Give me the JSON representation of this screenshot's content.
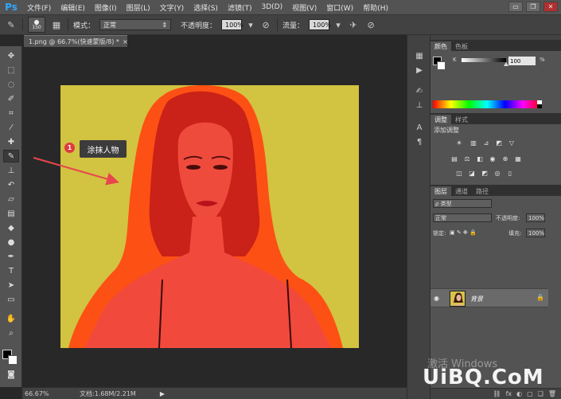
{
  "app": {
    "logo": "Ps"
  },
  "menubar": {
    "items": [
      "文件(F)",
      "编辑(E)",
      "图像(I)",
      "图层(L)",
      "文字(Y)",
      "选择(S)",
      "滤镜(T)",
      "3D(D)",
      "视图(V)",
      "窗口(W)",
      "帮助(H)"
    ]
  },
  "window_controls": {
    "minimize": "▭",
    "restore": "❐",
    "close": "✕"
  },
  "options": {
    "brush_size": "150",
    "mode_label": "模式：",
    "mode_value": "正常",
    "opacity_label": "不透明度：",
    "opacity_value": "100%",
    "flow_label": "流量：",
    "flow_value": "100%"
  },
  "document": {
    "tab_title": "1.png @ 66.7%(快速蒙版/8) *",
    "tab_close": "×"
  },
  "annotation": {
    "number": "1",
    "text": "涂抹人物"
  },
  "status": {
    "zoom": "66.67%",
    "doc_size": "文档:1.68M/2.21M",
    "arrow": "▶"
  },
  "color_panel": {
    "tabs": [
      "颜色",
      "色板"
    ],
    "channel_label": "K",
    "channel_value": "100",
    "unit": "%"
  },
  "adjustments_panel": {
    "tabs": [
      "调整",
      "样式"
    ],
    "title": "添加调整"
  },
  "layers_panel": {
    "tabs": [
      "图层",
      "通道",
      "路径"
    ],
    "kind_filter": "ρ 类型",
    "blend_mode": "正常",
    "opacity_label": "不透明度:",
    "opacity_value": "100%",
    "lock_label": "锁定:",
    "fill_label": "填充:",
    "fill_value": "100%",
    "layer_name": "背景",
    "footer_icons": [
      "⛓",
      "fx",
      "◐",
      "▢",
      "❑",
      "🗑"
    ]
  },
  "watermarks": {
    "windows": "激活 Windows",
    "site": "UiBQ.CoM"
  },
  "colors": {
    "quick_mask": "#ff3c1e",
    "image_background": "#cfc03a",
    "annotation_badge": "#e0393e",
    "arrow": "#e8464b"
  }
}
